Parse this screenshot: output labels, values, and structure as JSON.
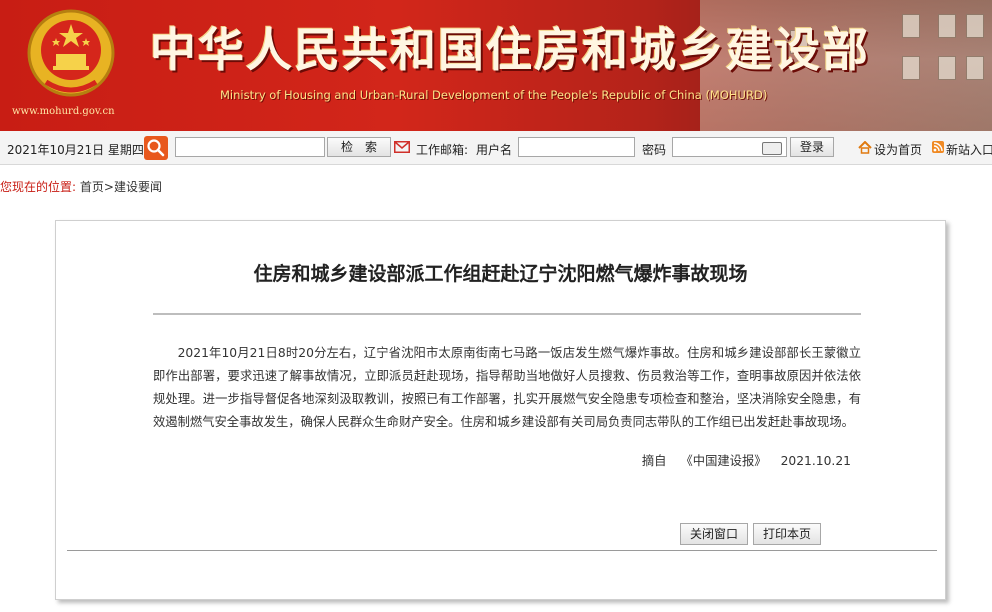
{
  "header": {
    "url": "www.mohurd.gov.cn",
    "title": "中华人民共和国住房和城乡建设部",
    "subtitle": "Ministry of Housing and Urban-Rural Development of the People's Republic of China (MOHURD)"
  },
  "toolbar": {
    "date": "2021年10月21日 星期四",
    "search_placeholder": "",
    "search_button": "检　索",
    "mail_label": "工作邮箱:",
    "user_label": "用户名",
    "password_label": "密码",
    "login_button": "登录",
    "set_home": "设为首页",
    "add_bookmark": "新站入口"
  },
  "breadcrumb": {
    "label": "您现在的位置:",
    "home": "首页",
    "sep": ">",
    "section": "建设要闻"
  },
  "article": {
    "title": "住房和城乡建设部派工作组赶赴辽宁沈阳燃气爆炸事故现场",
    "body": "2021年10月21日8时20分左右，辽宁省沈阳市太原南街南七马路一饭店发生燃气爆炸事故。住房和城乡建设部部长王蒙徽立即作出部署，要求迅速了解事故情况，立即派员赶赴现场，指导帮助当地做好人员搜救、伤员救治等工作，查明事故原因并依法依规处理。进一步指导督促各地深刻汲取教训，按照已有工作部署，扎实开展燃气安全隐患专项检查和整治，坚决消除安全隐患，有效遏制燃气安全事故发生，确保人民群众生命财产安全。住房和城乡建设部有关司局负责同志带队的工作组已出发赶赴事故现场。",
    "source_prefix": "摘自",
    "source_name": "《中国建设报》",
    "date": "2021.10.21",
    "close_button": "关闭窗口",
    "print_button": "打印本页"
  },
  "colors": {
    "banner_red": "#c81d14",
    "breadcrumb_label": "#c81d14"
  }
}
